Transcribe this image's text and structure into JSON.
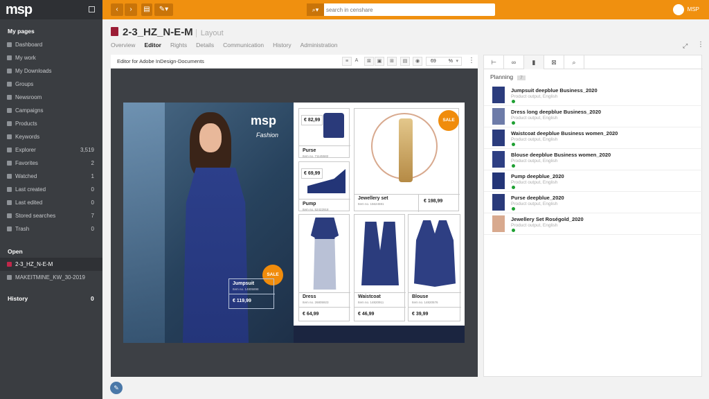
{
  "app": {
    "logo": "msp"
  },
  "sidebar": {
    "my_pages_heading": "My pages",
    "items": [
      {
        "label": "Dashboard",
        "count": "",
        "icon": "dashboard-icon"
      },
      {
        "label": "My work",
        "count": "",
        "icon": "briefcase-icon"
      },
      {
        "label": "My Downloads",
        "count": "",
        "icon": "download-icon"
      },
      {
        "label": "Groups",
        "count": "",
        "icon": "groups-icon"
      },
      {
        "label": "Newsroom",
        "count": "",
        "icon": "newsroom-icon"
      },
      {
        "label": "Campaigns",
        "count": "",
        "icon": "campaign-icon"
      },
      {
        "label": "Products",
        "count": "",
        "icon": "products-icon"
      },
      {
        "label": "Keywords",
        "count": "",
        "icon": "keyword-icon"
      },
      {
        "label": "Explorer",
        "count": "3,519",
        "icon": "explorer-icon"
      },
      {
        "label": "Favorites",
        "count": "2",
        "icon": "heart-icon"
      },
      {
        "label": "Watched",
        "count": "1",
        "icon": "eye-icon"
      },
      {
        "label": "Last created",
        "count": "0",
        "icon": "clock-icon"
      },
      {
        "label": "Last edited",
        "count": "0",
        "icon": "edit-icon"
      },
      {
        "label": "Stored searches",
        "count": "7",
        "icon": "search-icon"
      },
      {
        "label": "Trash",
        "count": "0",
        "icon": "trash-icon"
      }
    ],
    "open_heading": "Open",
    "open_items": [
      {
        "label": "2-3_HZ_N-E-M"
      },
      {
        "label": "MAKEITMINE_KW_30-2019"
      }
    ],
    "history_heading": "History",
    "history_count": "0"
  },
  "topbar": {
    "search_placeholder": "search in censhare",
    "user": "MSP"
  },
  "header": {
    "title": "2-3_HZ_N-E-M",
    "subtitle": "Layout",
    "tabs": [
      "Overview",
      "Editor",
      "Rights",
      "Details",
      "Communication",
      "History",
      "Administration"
    ],
    "active_tab": "Editor"
  },
  "editor": {
    "label": "Editor for Adobe InDesign-Documents",
    "zoom": "69",
    "zoom_unit": "%"
  },
  "layout_page": {
    "brand": "msp",
    "brand_sub": "Fashion",
    "sale": "SALE",
    "products": [
      {
        "name": "Jumpsuit",
        "item_no": "Item no. 14805898",
        "price": "€ 119,99"
      },
      {
        "name": "Purse",
        "item_no": "Item no. 71145582",
        "price": "€ 82,99"
      },
      {
        "name": "Pump",
        "item_no": "Item no. 52422918",
        "price": "€ 69,99"
      },
      {
        "name": "Jewellery set",
        "item_no": "Item no. 15624591",
        "price": "€ 198,99"
      },
      {
        "name": "Dress",
        "item_no": "Item no. 26805923",
        "price": "€ 64,99"
      },
      {
        "name": "Waistcoat",
        "item_no": "Item no. 14820911",
        "price": "€ 46,99"
      },
      {
        "name": "Blouse",
        "item_no": "Item no. 14820576",
        "price": "€ 39,99"
      }
    ]
  },
  "right_panel": {
    "section": "Planning",
    "count": "7",
    "items": [
      {
        "name": "Jumpsuit deepblue Business_2020",
        "desc": "Product output, English"
      },
      {
        "name": "Dress long deepblue Business_2020",
        "desc": "Product output, English"
      },
      {
        "name": "Waistcoat deepblue Business women_2020",
        "desc": "Product output, English"
      },
      {
        "name": "Blouse deepblue Business women_2020",
        "desc": "Product output, English"
      },
      {
        "name": "Pump deepblue_2020",
        "desc": "Product output, English"
      },
      {
        "name": "Purse deepblue_2020",
        "desc": "Product output, English"
      },
      {
        "name": "Jewellery Set Roségold_2020",
        "desc": "Product output, English"
      }
    ]
  }
}
